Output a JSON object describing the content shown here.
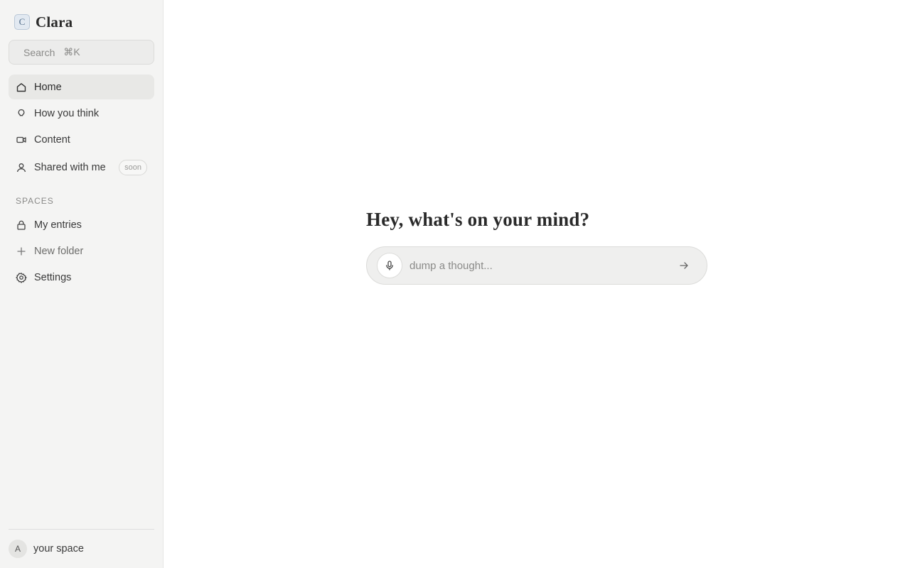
{
  "app": {
    "logo_letter": "C",
    "name": "Clara"
  },
  "search": {
    "label": "Search",
    "shortcut": "⌘K"
  },
  "nav": {
    "home": "Home",
    "how_you_think": "How you think",
    "content": "Content",
    "shared_with_me": "Shared with me",
    "shared_badge": "soon"
  },
  "spaces": {
    "label": "SPACES",
    "my_entries": "My entries",
    "new_folder": "New folder",
    "settings": "Settings"
  },
  "footer": {
    "avatar_letter": "A",
    "label": "your space"
  },
  "main": {
    "greeting": "Hey, what's on your mind?",
    "input_placeholder": "dump a thought..."
  },
  "icons": {
    "home": "home-icon",
    "how_you_think": "lightbulb-icon",
    "content": "video-icon",
    "shared": "user-icon",
    "my_entries": "lock-icon",
    "new_folder": "plus-icon",
    "settings": "gear-icon",
    "mic": "microphone-icon",
    "send": "arrow-right-icon"
  }
}
